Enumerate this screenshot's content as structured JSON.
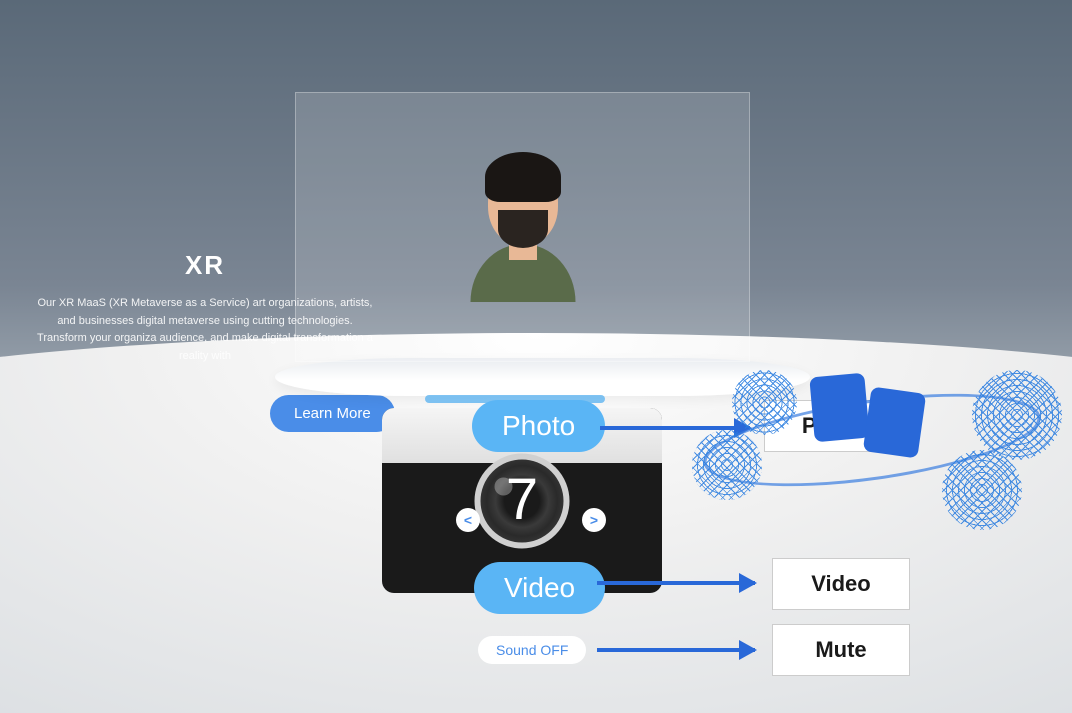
{
  "xr": {
    "title": "XR",
    "description": "Our XR MaaS (XR Metaverse as a Service) art organizations, artists, and businesses digital metaverse using cutting technologies. Transform your organiza audience, and make digital transformation a reality with",
    "learn_more": "Learn More"
  },
  "camera": {
    "counter": "7",
    "prev": "<",
    "next": ">"
  },
  "buttons": {
    "photo": "Photo",
    "video": "Video",
    "sound": "Sound OFF"
  },
  "labels": {
    "photo": "Photo",
    "video": "Video",
    "mute": "Mute"
  }
}
